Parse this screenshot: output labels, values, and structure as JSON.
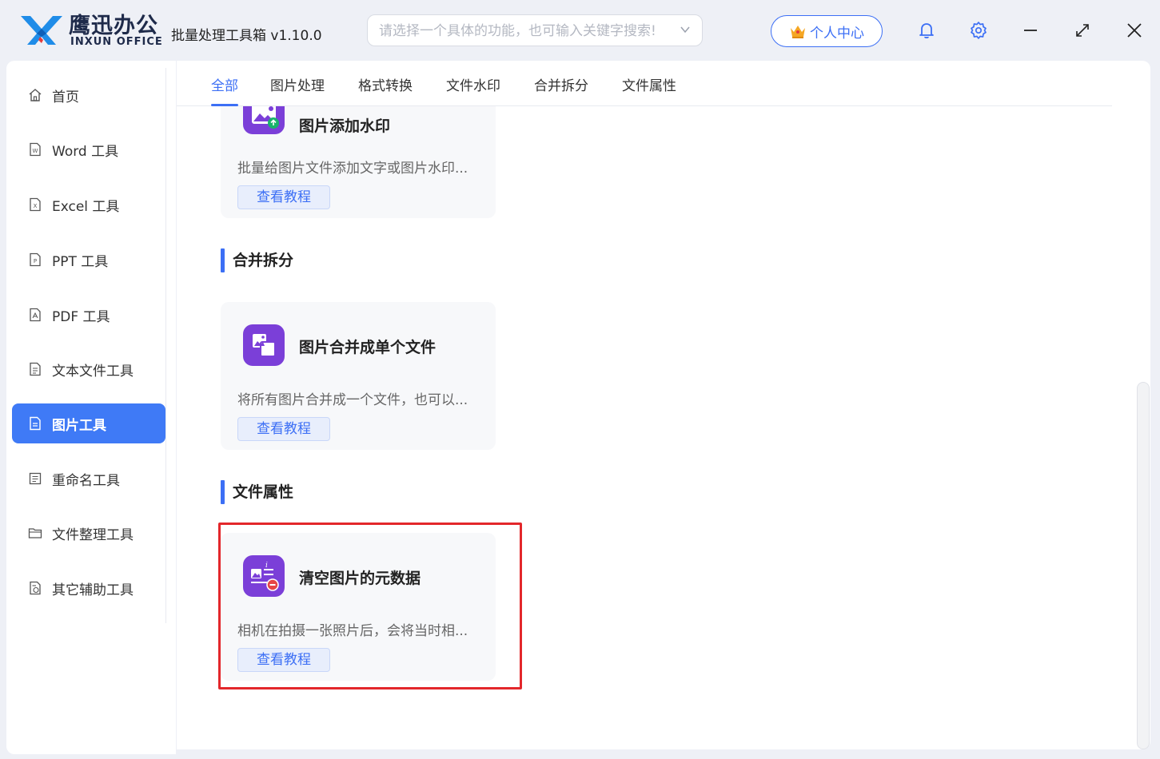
{
  "brand": {
    "name_cn": "鹰迅办公",
    "name_en": "INXUN OFFICE"
  },
  "app_title": "批量处理工具箱 v1.10.0",
  "search": {
    "placeholder": "请选择一个具体的功能，也可输入关键字搜索!"
  },
  "header": {
    "user_center_label": "个人中心"
  },
  "sidebar": {
    "items": [
      {
        "label": "首页",
        "icon": "home-icon"
      },
      {
        "label": "Word 工具",
        "icon": "word-doc-icon"
      },
      {
        "label": "Excel 工具",
        "icon": "excel-doc-icon"
      },
      {
        "label": "PPT 工具",
        "icon": "ppt-doc-icon"
      },
      {
        "label": "PDF 工具",
        "icon": "pdf-doc-icon"
      },
      {
        "label": "文本文件工具",
        "icon": "text-file-icon"
      },
      {
        "label": "图片工具",
        "icon": "image-file-icon",
        "active": true
      },
      {
        "label": "重命名工具",
        "icon": "rename-icon"
      },
      {
        "label": "文件整理工具",
        "icon": "folder-icon"
      },
      {
        "label": "其它辅助工具",
        "icon": "tools-icon"
      }
    ]
  },
  "tabs": [
    {
      "label": "全部",
      "active": true
    },
    {
      "label": "图片处理"
    },
    {
      "label": "格式转换"
    },
    {
      "label": "文件水印"
    },
    {
      "label": "合并拆分"
    },
    {
      "label": "文件属性"
    }
  ],
  "cards": [
    {
      "title": "图片添加水印",
      "desc": "批量给图片文件添加文字或图片水印...",
      "button": "查看教程",
      "icon": "image-watermark-icon"
    },
    {
      "title": "图片合并成单个文件",
      "desc": "将所有图片合并成一个文件，也可以...",
      "button": "查看教程",
      "icon": "image-merge-icon"
    },
    {
      "title": "清空图片的元数据",
      "desc": "相机在拍摄一张照片后，会将当时相...",
      "button": "查看教程",
      "icon": "clear-metadata-icon"
    }
  ],
  "sections": {
    "merge_split": "合并拆分",
    "file_props": "文件属性"
  },
  "colors": {
    "accent": "#3c6ff5",
    "active_nav": "#3f7af6",
    "highlight_border": "#e3272b",
    "card_icon_bg": "#7b3fd8"
  }
}
